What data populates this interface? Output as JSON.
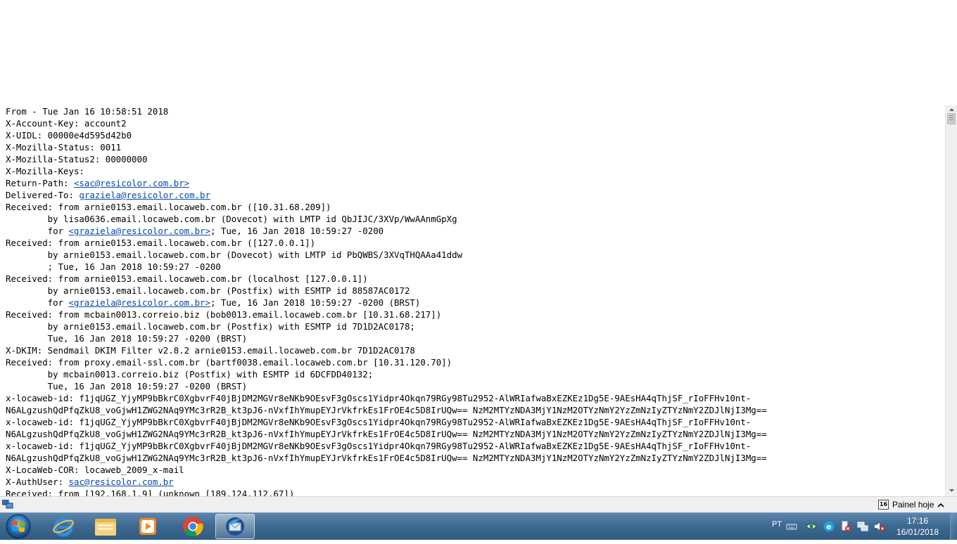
{
  "header_lines": [
    [
      {
        "t": "From - Tue Jan 16 10:58:51 2018"
      }
    ],
    [
      {
        "t": "X-Account-Key: account2"
      }
    ],
    [
      {
        "t": "X-UIDL: 00000e4d595d42b0"
      }
    ],
    [
      {
        "t": "X-Mozilla-Status: 0011"
      }
    ],
    [
      {
        "t": "X-Mozilla-Status2: 00000000"
      }
    ],
    [
      {
        "t": "X-Mozilla-Keys:"
      }
    ],
    [
      {
        "t": "Return-Path: "
      },
      {
        "t": "<sac@resicolor.com.br>",
        "link": true
      }
    ],
    [
      {
        "t": "Delivered-To: "
      },
      {
        "t": "graziela@resicolor.com.br",
        "link": true
      }
    ],
    [
      {
        "t": "Received: from arnie0153.email.locaweb.com.br ([10.31.68.209])"
      }
    ],
    [
      {
        "t": "        by lisa0636.email.locaweb.com.br (Dovecot) with LMTP id QbJIJC/3XVp/WwAAnmGpXg"
      }
    ],
    [
      {
        "t": "        for "
      },
      {
        "t": "<graziela@resicolor.com.br>",
        "link": true
      },
      {
        "t": "; Tue, 16 Jan 2018 10:59:27 -0200"
      }
    ],
    [
      {
        "t": "Received: from arnie0153.email.locaweb.com.br ([127.0.0.1])"
      }
    ],
    [
      {
        "t": "        by arnie0153.email.locaweb.com.br (Dovecot) with LMTP id PbQWBS/3XVqTHQAAa41ddw"
      }
    ],
    [
      {
        "t": "        ; Tue, 16 Jan 2018 10:59:27 -0200"
      }
    ],
    [
      {
        "t": "Received: from arnie0153.email.locaweb.com.br (localhost [127.0.0.1])"
      }
    ],
    [
      {
        "t": "        by arnie0153.email.locaweb.com.br (Postfix) with ESMTP id 88587AC0172"
      }
    ],
    [
      {
        "t": "        for "
      },
      {
        "t": "<graziela@resicolor.com.br>",
        "link": true
      },
      {
        "t": "; Tue, 16 Jan 2018 10:59:27 -0200 (BRST)"
      }
    ],
    [
      {
        "t": "Received: from mcbain0013.correio.biz (bob0013.email.locaweb.com.br [10.31.68.217])"
      }
    ],
    [
      {
        "t": "        by arnie0153.email.locaweb.com.br (Postfix) with ESMTP id 7D1D2AC0178;"
      }
    ],
    [
      {
        "t": "        Tue, 16 Jan 2018 10:59:27 -0200 (BRST)"
      }
    ],
    [
      {
        "t": "X-DKIM: Sendmail DKIM Filter v2.8.2 arnie0153.email.locaweb.com.br 7D1D2AC0178"
      }
    ],
    [
      {
        "t": "Received: from proxy.email-ssl.com.br (bartf0038.email.locaweb.com.br [10.31.120.70])"
      }
    ],
    [
      {
        "t": "        by mcbain0013.correio.biz (Postfix) with ESMTP id 6DCFDD40132;"
      }
    ],
    [
      {
        "t": "        Tue, 16 Jan 2018 10:59:27 -0200 (BRST)"
      }
    ],
    [
      {
        "t": "x-locaweb-id: f1jqUGZ_YjyMP9bBkrC0XgbvrF40jBjDM2MGVr8eNKb9OEsvF3gOscs1Yidpr4Okqn79RGy98Tu2952-AlWRIafwaBxEZKEz1Dg5E-9AEsHA4qThjSF_rIoFFHv10nt-"
      }
    ],
    [
      {
        "t": "N6ALgzushQdPfqZkU8_voGjwH1ZWG2NAq9YMc3rR2B_kt3pJ6-nVxfIhYmupEYJrVkfrkEs1FrOE4c5D8IrUQw== NzM2MTYzNDA3MjY1NzM2OTYzNmY2YzZmNzIyZTYzNmY2ZDJlNjI3Mg=="
      }
    ],
    [
      {
        "t": "x-locaweb-id: f1jqUGZ_YjyMP9bBkrC0XgbvrF40jBjDM2MGVr8eNKb9OEsvF3gOscs1Yidpr4Okqn79RGy98Tu2952-AlWRIafwaBxEZKEz1Dg5E-9AEsHA4qThjSF_rIoFFHv10nt-"
      }
    ],
    [
      {
        "t": "N6ALgzushQdPfqZkU8_voGjwH1ZWG2NAq9YMc3rR2B_kt3pJ6-nVxfIhYmupEYJrVkfrkEs1FrOE4c5D8IrUQw== NzM2MTYzNDA3MjY1NzM2OTYzNmY2YzZmNzIyZTYzNmY2ZDJlNjI3Mg=="
      }
    ],
    [
      {
        "t": "x-locaweb-id: f1jqUGZ_YjyMP9bBkrC0XgbvrF40jBjDM2MGVr8eNKb9OEsvF3gOscs1Yidpr4Okqn79RGy98Tu2952-AlWRIafwaBxEZKEz1Dg5E-9AEsHA4qThjSF_rIoFFHv10nt-"
      }
    ],
    [
      {
        "t": "N6ALgzushQdPfqZkU8_voGjwH1ZWG2NAq9YMc3rR2B_kt3pJ6-nVxfIhYmupEYJrVkfrkEs1FrOE4c5D8IrUQw== NzM2MTYzNDA3MjY1NzM2OTYzNmY2YzZmNzIyZTYzNmY2ZDJlNjI3Mg=="
      }
    ],
    [
      {
        "t": "X-LocaWeb-COR: locaweb_2009_x-mail"
      }
    ],
    [
      {
        "t": "X-AuthUser: "
      },
      {
        "t": "sac@resicolor.com.br",
        "link": true
      }
    ],
    [
      {
        "t": "Received: from [192.168.1.9] (unknown [189.124.112.67])"
      }
    ]
  ],
  "status_bar": {
    "today_pane_label": "Painel hoje",
    "calendar_day": "16"
  },
  "taskbar": {
    "apps": [
      {
        "name": "internet-explorer"
      },
      {
        "name": "file-explorer"
      },
      {
        "name": "media-player"
      },
      {
        "name": "google-chrome"
      },
      {
        "name": "thunderbird",
        "active": true
      }
    ],
    "tray": {
      "language": "PT",
      "time": "17:16",
      "date": "16/01/2018"
    }
  },
  "colors": {
    "link": "#0645ad",
    "taskbar": "#3f6a92",
    "status_bar": "#f0f0f0"
  }
}
